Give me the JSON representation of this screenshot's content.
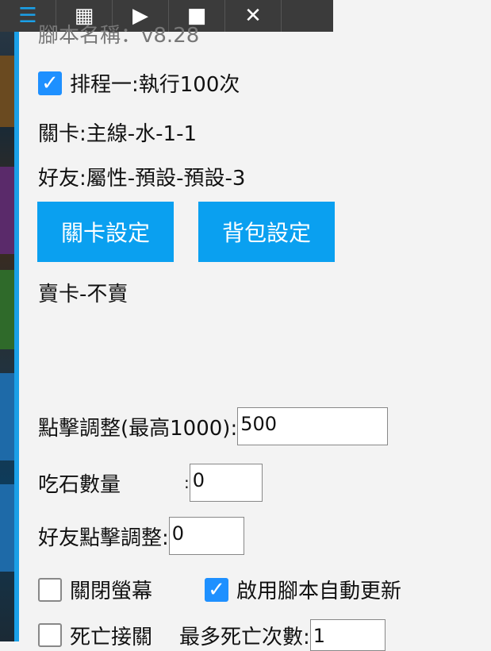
{
  "toolbar": {
    "buttons": [
      {
        "icon": "menu-icon",
        "glyph": "☰"
      },
      {
        "icon": "grid-icon",
        "glyph": "▦"
      },
      {
        "icon": "play-icon",
        "glyph": "▶"
      },
      {
        "icon": "stop-icon",
        "glyph": "■"
      },
      {
        "icon": "close-icon",
        "glyph": "✕"
      }
    ]
  },
  "script_title": "腳本名稱：v8.28",
  "schedule": {
    "checked": true,
    "label": "排程一:執行100次"
  },
  "stage_text": "關卡:主線-水-1-1",
  "friend_text": "好友:屬性-預設-預設-3",
  "buttons": {
    "stage_settings": "關卡設定",
    "bag_settings": "背包設定"
  },
  "sell_card": "賣卡-不賣",
  "click_adjust": {
    "label": "點擊調整(最高1000):",
    "value": "500"
  },
  "stone_count": {
    "label": "吃石數量",
    "colon": ":",
    "value": "0"
  },
  "friend_click_adjust": {
    "label": "好友點擊調整:",
    "value": "0"
  },
  "screen_off": {
    "checked": false,
    "label": "關閉螢幕"
  },
  "auto_update": {
    "checked": true,
    "label": "啟用腳本自動更新"
  },
  "death_continue": {
    "checked": false,
    "label": "死亡接關",
    "max_label": "最多死亡次數:",
    "value": "1"
  }
}
